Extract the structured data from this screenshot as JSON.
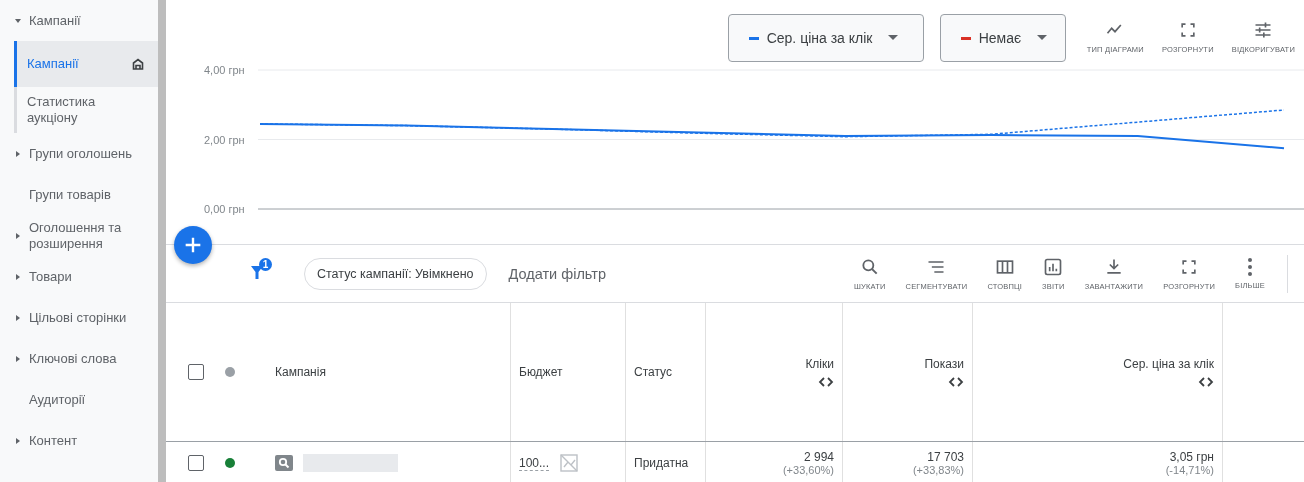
{
  "sidebar": {
    "items": [
      {
        "kind": "group",
        "label": "Кампанії",
        "expanded": true,
        "selected": false,
        "children": [
          {
            "label": "Кампанії",
            "selected": true,
            "home": true
          },
          {
            "label": "Статистика аукціону",
            "selected": false,
            "home": false
          }
        ]
      },
      {
        "kind": "group",
        "label": "Групи оголошень",
        "expanded": false,
        "selected": false
      },
      {
        "kind": "link",
        "label": "Групи товарів",
        "selected": false
      },
      {
        "kind": "group",
        "label": "Оголошення та розширення",
        "expanded": false,
        "selected": false
      },
      {
        "kind": "group",
        "label": "Товари",
        "expanded": false,
        "selected": false
      },
      {
        "kind": "group",
        "label": "Цільові сторінки",
        "expanded": false,
        "selected": false
      },
      {
        "kind": "group",
        "label": "Ключові слова",
        "expanded": false,
        "selected": false
      },
      {
        "kind": "link",
        "label": "Аудиторії",
        "selected": false
      },
      {
        "kind": "group",
        "label": "Контент",
        "expanded": false,
        "selected": false
      }
    ]
  },
  "chart_panel": {
    "metrics": [
      {
        "label": "Сер. ціна за клік",
        "color": "#1a73e8"
      },
      {
        "label": "Немає",
        "color": "#d93025"
      }
    ],
    "actions": [
      {
        "kind": "chart-type",
        "label": "ТИП ДІАГРАМИ"
      },
      {
        "kind": "expand",
        "label": "РОЗГОРНУТИ"
      },
      {
        "kind": "adjust",
        "label": "ВІДКОРИГУВАТИ"
      }
    ],
    "chart_data": {
      "type": "line",
      "ylim": [
        0,
        4
      ],
      "yticks": [
        {
          "value": 0,
          "label": "0,00 грн"
        },
        {
          "value": 2,
          "label": "2,00 грн"
        },
        {
          "value": 4,
          "label": "4,00 грн"
        }
      ],
      "series": [
        {
          "color": "#1a73e8",
          "line_style": "solid",
          "values": [
            2.45,
            2.4,
            2.3,
            2.2,
            2.1,
            2.13,
            2.1,
            1.75
          ]
        },
        {
          "color": "#1a73e8",
          "line_style": "dashed",
          "values": [
            2.45,
            2.4,
            2.3,
            2.18,
            2.08,
            2.15,
            2.5,
            2.85
          ]
        }
      ]
    }
  },
  "filter_bar": {
    "filter_count": "1",
    "chips": [
      "Статус кампанії: Увімкнено"
    ],
    "add_filter": "Додати фільтр",
    "tools": [
      {
        "kind": "search",
        "label": "ШУКАТИ"
      },
      {
        "kind": "segment",
        "label": "СЕГМЕНТУВАТИ"
      },
      {
        "kind": "columns",
        "label": "СТОВПЦІ"
      },
      {
        "kind": "reports",
        "label": "ЗВІТИ"
      },
      {
        "kind": "download",
        "label": "ЗАВАНТАЖИТИ"
      },
      {
        "kind": "expand",
        "label": "РОЗГОРНУТИ"
      },
      {
        "kind": "more",
        "label": "БІЛЬШЕ"
      }
    ]
  },
  "table": {
    "header": {
      "checked": false,
      "color": "#9aa0a6"
    },
    "columns": [
      {
        "label": "Кампанія",
        "sortable": false
      },
      {
        "label": "Бюджет",
        "sortable": false
      },
      {
        "label": "Статус",
        "sortable": false
      },
      {
        "label": "Кліки",
        "sortable": true
      },
      {
        "label": "Покази",
        "sortable": true
      },
      {
        "label": "Сер. ціна за клік",
        "sortable": true
      }
    ],
    "rows": [
      {
        "checked": false,
        "color": "#188038",
        "campaign": {
          "kind": "search"
        },
        "budget": "100...",
        "status": "Придатна",
        "clicks": {
          "value": "2 994",
          "change": "(+33,60%)"
        },
        "impressions": {
          "value": "17 703",
          "change": "(+33,83%)"
        },
        "avg_cpc": {
          "value": "3,05 грн",
          "change": "(-14,71%)"
        }
      }
    ]
  }
}
